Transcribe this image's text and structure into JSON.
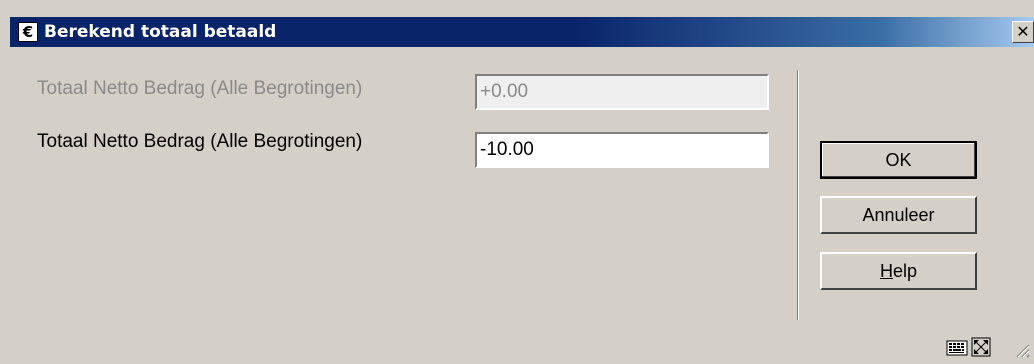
{
  "window": {
    "title": "Berekend totaal betaald",
    "title_icon_glyph": "€",
    "close_glyph": "✕"
  },
  "fields": [
    {
      "label": "Totaal Netto Bedrag (Alle Begrotingen)",
      "value": "+0.00",
      "state": "disabled"
    },
    {
      "label": "Totaal Netto Bedrag (Alle Begrotingen)",
      "value": "-10.00",
      "state": "enabled"
    }
  ],
  "buttons": {
    "ok": "OK",
    "cancel": "Annuleer",
    "help_mnemonic": "H",
    "help_rest": "elp"
  },
  "status_bar": {
    "icons": [
      "keyboard-icon",
      "maximize-icon",
      "resize-grip-icon"
    ]
  },
  "colors": {
    "titlebar_start": "#0a246a",
    "titlebar_end": "#a6caf0",
    "dialog_bg": "#d4d0c8",
    "disabled_text": "#8a8a8a"
  }
}
